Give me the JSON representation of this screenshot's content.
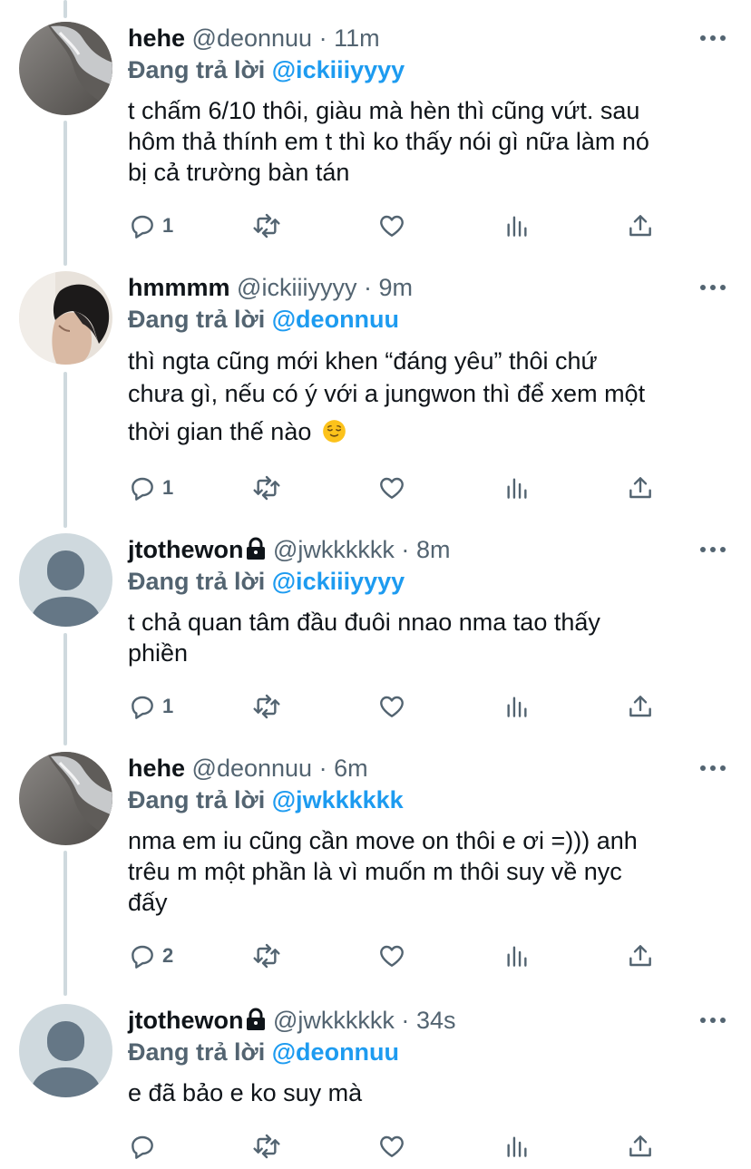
{
  "reply_prefix": "Đang trả lời",
  "tweets": [
    {
      "name": "hehe",
      "handle": "@deonnuu",
      "time": "11m",
      "reply_to": "@ickiiiyyyy",
      "lines": [
        "t chấm 6/10 thôi, giàu mà hèn thì cũng vứt. sau",
        "hôm thả thính em t thì ko thấy nói gì nữa làm nó",
        "bị cả trường bàn tán"
      ],
      "reply_count": "1",
      "avatar_icon": "beach-shore-avatar",
      "locked": false
    },
    {
      "name": "hmmmm",
      "handle": "@ickiiiyyyy",
      "time": "9m",
      "reply_to": "@deonnuu",
      "lines": [
        "thì ngta cũng mới khen “đáng yêu” thôi chứ",
        "chưa gì, nếu có ý với a jungwon thì để xem một",
        "thời gian thế nào"
      ],
      "emoji": "relieved-face-emoji",
      "reply_count": "1",
      "avatar_icon": "person-photo-avatar",
      "locked": false
    },
    {
      "name": "jtothewon",
      "handle": "@jwkkkkkk",
      "time": "8m",
      "reply_to": "@ickiiiyyyy",
      "lines": [
        "t chả quan tâm đầu đuôi nnao nma tao thấy",
        "phiền"
      ],
      "reply_count": "1",
      "avatar_icon": "default-profile-avatar",
      "locked": true
    },
    {
      "name": "hehe",
      "handle": "@deonnuu",
      "time": "6m",
      "reply_to": "@jwkkkkkk",
      "lines": [
        "nma em iu cũng cần move on thôi e ơi =))) anh",
        "trêu m một phần là vì muốn m thôi suy về nyc",
        "đấy"
      ],
      "reply_count": "2",
      "avatar_icon": "beach-shore-avatar",
      "locked": false
    },
    {
      "name": "jtothewon",
      "handle": "@jwkkkkkk",
      "time": "34s",
      "reply_to": "@deonnuu",
      "lines": [
        "e đã bảo e ko suy mà"
      ],
      "reply_count": "",
      "avatar_icon": "default-profile-avatar",
      "locked": true
    }
  ],
  "colors": {
    "text": "#0f1419",
    "secondary": "#536471",
    "mention": "#1d9bf0",
    "thread_line": "#cfd9de"
  }
}
